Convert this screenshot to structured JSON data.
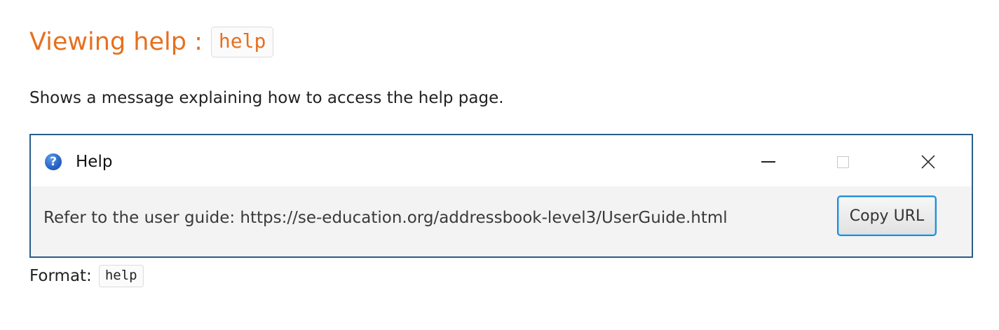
{
  "heading": {
    "text": "Viewing help :",
    "code": "help"
  },
  "description": "Shows a message explaining how to access the help page.",
  "help_window": {
    "title": "Help",
    "icon_glyph": "?",
    "icon_name": "help-question-icon",
    "controls": {
      "minimize_icon": "minimize-icon",
      "maximize_icon": "maximize-icon",
      "close_icon": "close-icon",
      "close_glyph": "✕"
    },
    "message": "Refer to the user guide: https://se-education.org/addressbook-level3/UserGuide.html",
    "button_label": "Copy URL"
  },
  "format": {
    "label": "Format:",
    "code": "help"
  },
  "colors": {
    "heading": "#e76f1d",
    "window_border": "#2b5d8a",
    "button_focus": "#1f8fd6",
    "help_icon": "#2a66c8"
  }
}
